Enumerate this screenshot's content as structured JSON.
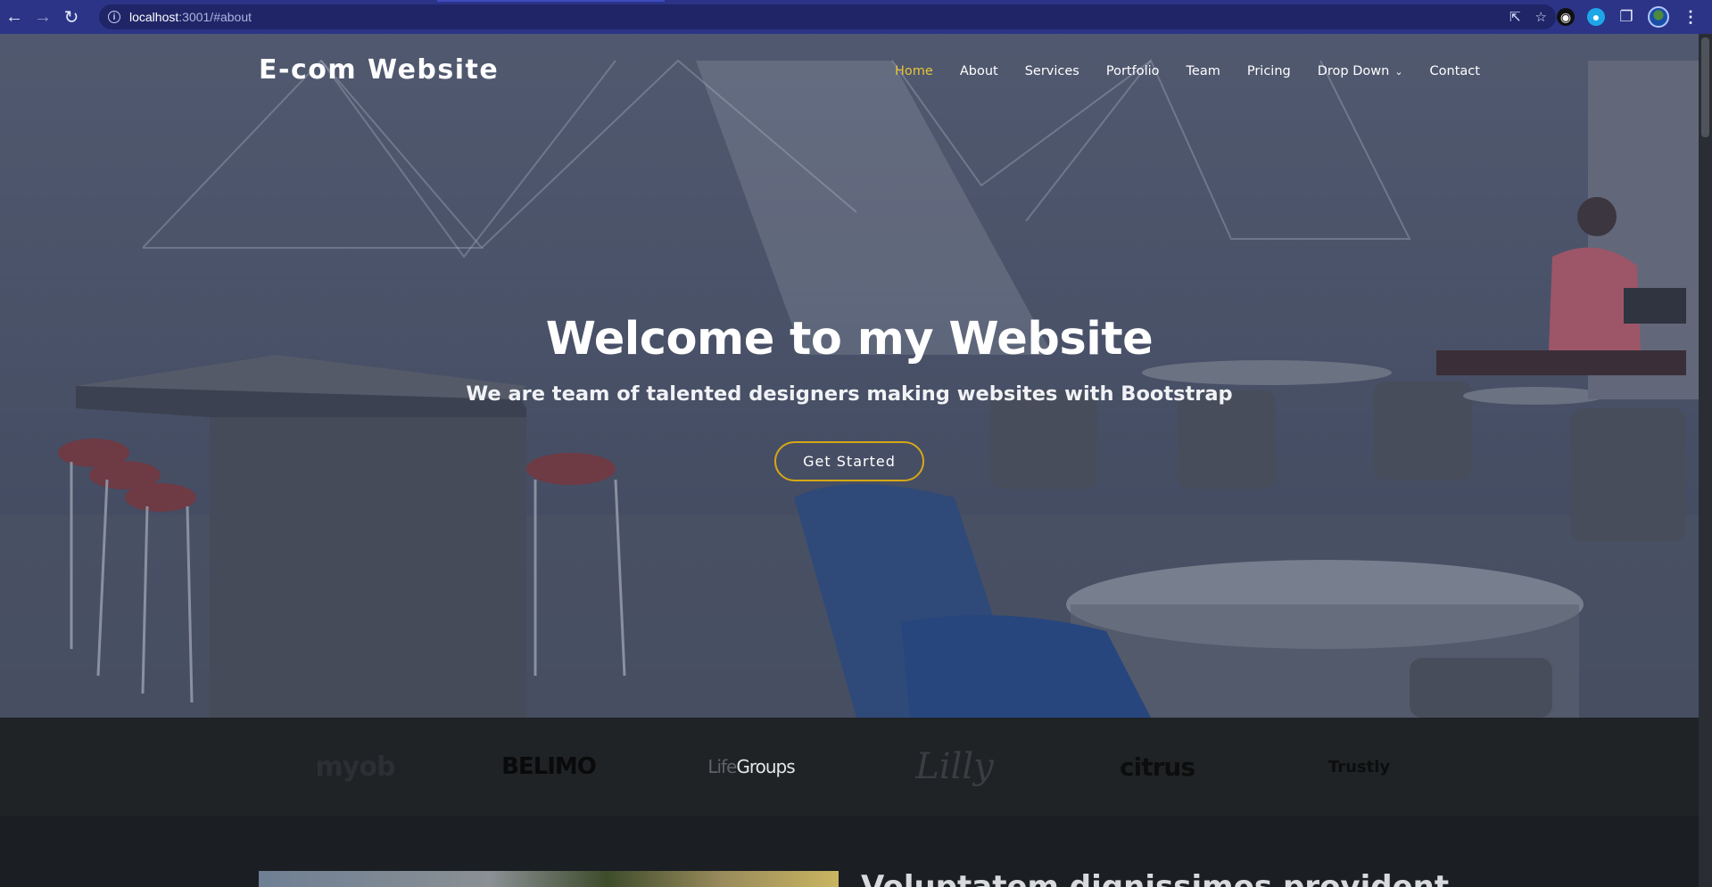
{
  "browser": {
    "url_host": "localhost",
    "url_path": ":3001/#about"
  },
  "header": {
    "logo": "E-com Website",
    "nav": [
      {
        "label": "Home",
        "active": true
      },
      {
        "label": "About"
      },
      {
        "label": "Services"
      },
      {
        "label": "Portfolio"
      },
      {
        "label": "Team"
      },
      {
        "label": "Pricing"
      },
      {
        "label": "Drop Down",
        "has_dropdown": true
      },
      {
        "label": "Contact"
      }
    ]
  },
  "hero": {
    "title": "Welcome to my Website",
    "subtitle": "We are team of talented designers making websites with Bootstrap",
    "cta_label": "Get Started"
  },
  "clients": [
    {
      "name": "myob"
    },
    {
      "name": "BELIMO"
    },
    {
      "name_a": "Life",
      "name_b": "Groups"
    },
    {
      "name": "Lilly"
    },
    {
      "name": "citrus"
    },
    {
      "name": "Trustly"
    }
  ],
  "about": {
    "title": "Voluptatem dignissimos provident"
  },
  "colors": {
    "accent": "#e7c33a",
    "cta_border": "#d6a716",
    "browser_bar": "#2b3486",
    "clients_bg": "#1f2326"
  }
}
